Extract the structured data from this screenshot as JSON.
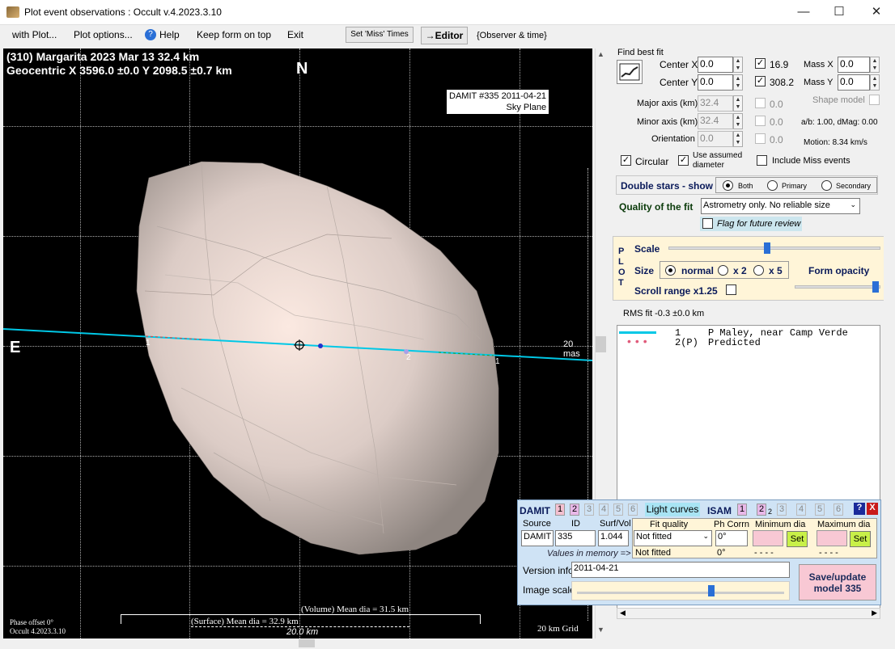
{
  "window": {
    "title": "Plot event observations : Occult v.4.2023.3.10",
    "minimize": "—",
    "maximize": "☐",
    "close": "✕"
  },
  "menu": {
    "items": [
      "with Plot...",
      "Plot options...",
      "Help",
      "Keep form on top",
      "Exit"
    ],
    "set_miss_times": "Set 'Miss' Times",
    "editor": "→Editor",
    "observer_time": "{Observer & time}"
  },
  "plot": {
    "title_line1": "(310) Margarita  2023 Mar 13   32.4 km",
    "title_line2": "Geocentric  X  3596.0 ±0.0  Y 2098.5 ±0.7 km",
    "north": "N",
    "east": "E",
    "model_label_1": "DAMIT #335 2011-04-21",
    "model_label_2": "Sky Plane",
    "mas_label": "20 mas",
    "chord_1_left_label": "1",
    "chord_2_label": "2",
    "chord_1_right_label": "1",
    "phase_offset": "Phase offset 0°",
    "version": "Occult 4.2023.3.10",
    "volume_dia": "(Volume) Mean dia = 31.5 km",
    "surface_dia": "(Surface) Mean dia = 32.9 km",
    "scale_km": "20.0 km",
    "grid": "20 km Grid"
  },
  "fit": {
    "find_best_fit": "Find best fit",
    "center_x_label": "Center X",
    "center_x": "0.0",
    "center_y_label": "Center Y",
    "center_y": "0.0",
    "major_label": "Major axis (km)",
    "major": "32.4",
    "minor_label": "Minor axis (km)",
    "minor": "32.4",
    "orient_label": "Orientation",
    "orient": "0.0",
    "chk1_val": "16.9",
    "chk2_val": "308.2",
    "chk3_val": "0.0",
    "chk4_val": "0.0",
    "chk5_val": "0.0",
    "mass_x_label": "Mass X",
    "mass_x": "0.0",
    "mass_y_label": "Mass Y",
    "mass_y": "0.0",
    "shape_model": "Shape model",
    "ab_dmag": "a/b: 1.00, dMag: 0.00",
    "motion": "Motion: 8.34 km/s",
    "circular": "Circular",
    "use_assumed": "Use assumed",
    "diameter": "diameter",
    "include_miss": "Include Miss events",
    "double_stars": "Double stars - show",
    "both": "Both",
    "primary": "Primary",
    "secondary": "Secondary",
    "quality_label": "Quality of the fit",
    "quality_value": "Astrometry only. No reliable size",
    "flag_review": "Flag for future review"
  },
  "plotctl": {
    "p": "P",
    "l": "L",
    "o": "O",
    "t": "T",
    "scale": "Scale",
    "size": "Size",
    "normal": "normal",
    "x2": "x 2",
    "x5": "x 5",
    "form_opacity": "Form opacity",
    "scroll_range": "Scroll range x1.25",
    "scale_pct": 0.46,
    "opacity_pct": 0.97
  },
  "legend": {
    "rms": "RMS fit -0.3 ±0.0 km",
    "row1_num": "1",
    "row1_name": "P Maley, near Camp Verde",
    "row2_num": "2(P)",
    "row2_name": "Predicted"
  },
  "damit": {
    "title": "DAMIT",
    "nums": [
      "1",
      "2",
      "3",
      "4",
      "5",
      "6"
    ],
    "light_curves": "Light curves",
    "isam": "ISAM",
    "isam_nums": [
      "1",
      "2",
      "2",
      "3",
      "4",
      "5",
      "6"
    ],
    "help": "?",
    "close": "X",
    "source_label": "Source",
    "id_label": "ID",
    "sv_label": "Surf/Vol",
    "source": "DAMIT",
    "id": "335",
    "sv": "1.044",
    "fit_quality_label": "Fit quality",
    "fit_quality": "Not fitted",
    "ph_corr_label": "Ph Corrn",
    "ph_corr": "0°",
    "min_dia_label": "Minimum dia",
    "max_dia_label": "Maximum dia",
    "set": "Set",
    "values_in_memory": "Values in memory =>",
    "mem_fit": "Not fitted",
    "mem_ph": "0°",
    "mem_min": "- - - -",
    "mem_max": "- - - -",
    "version_label": "Version info",
    "version": "2011-04-21",
    "image_scale": "Image scale",
    "save_line1": "Save/update",
    "save_line2": "model 335",
    "image_scale_pct": 0.64
  },
  "colors": {
    "accent": "#00c8e6",
    "predicted": "#e05a7a"
  }
}
